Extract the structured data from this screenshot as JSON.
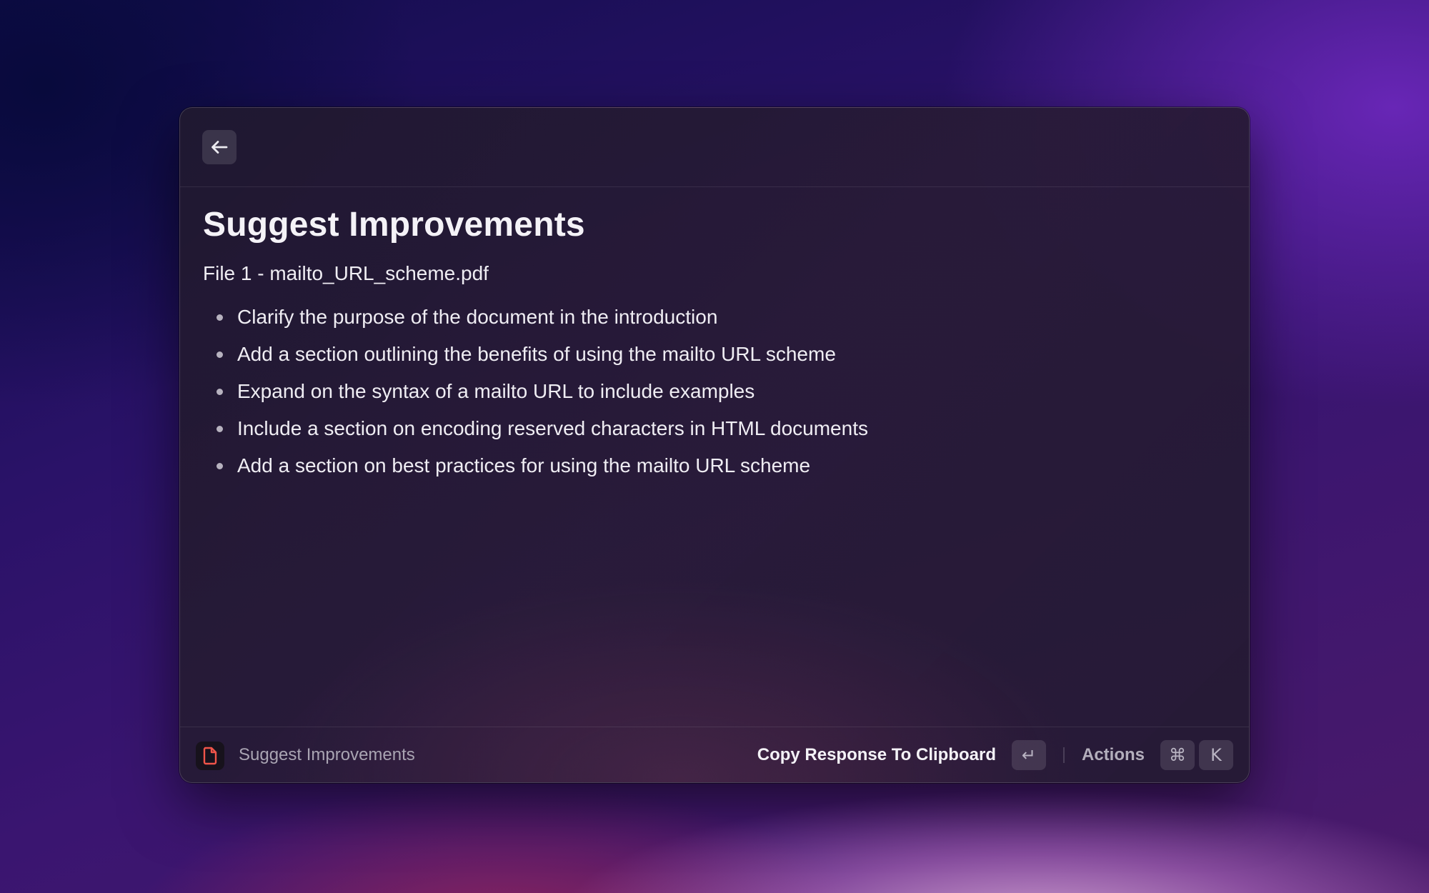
{
  "window": {
    "back_icon": "arrow-left-icon"
  },
  "main": {
    "title": "Suggest Improvements",
    "file_label": "File 1 - mailto_URL_scheme.pdf",
    "suggestions": [
      "Clarify the purpose of the document in the introduction",
      "Add a section outlining the benefits of using the mailto URL scheme",
      "Expand on the syntax of a mailto URL to include examples",
      "Include a section on encoding reserved characters in HTML documents",
      "Add a section on best practices for using the mailto URL scheme"
    ]
  },
  "footer": {
    "app_icon": "document-icon",
    "app_icon_color": "#f0554a",
    "command_name": "Suggest Improvements",
    "primary_action": "Copy Response To Clipboard",
    "primary_shortcut": "↵",
    "actions_label": "Actions",
    "actions_shortcut_modifier": "⌘",
    "actions_shortcut_key": "K"
  }
}
